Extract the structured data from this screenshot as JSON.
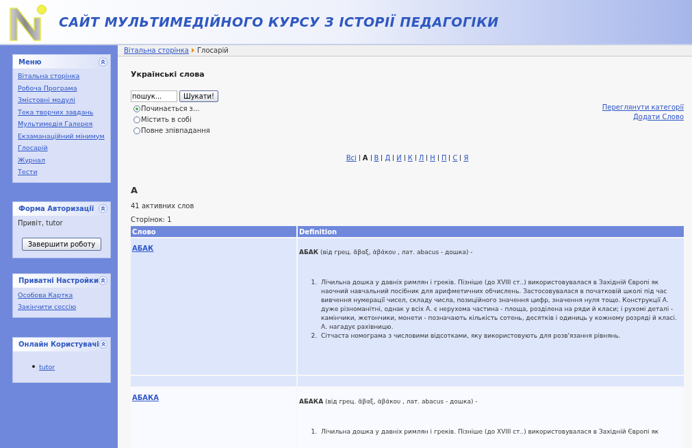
{
  "header": {
    "title": "САЙТ МУЛЬТИМЕДІЙНОГО КУРСУ З ІСТОРІЇ ПЕДАГОГІКИ"
  },
  "sidebar": {
    "menu": {
      "title": "Меню",
      "items": [
        "Вітальна сторінка",
        "Робоча Програма",
        "Змістовні модулі",
        "Тека творчих завдань",
        "Мультимедія Галерея",
        "Екзаманаційний мінимум",
        "Глосарій",
        "Журнал",
        "Тести"
      ]
    },
    "login": {
      "title": "Форма Авторизації",
      "greeting": "Привіт, tutor",
      "button": "Завершити роботу"
    },
    "settings": {
      "title": "Приватні Настройки",
      "items": [
        "Особова Картка",
        "Закінчити сессію"
      ]
    },
    "online": {
      "title": "Онлайн Користувачі",
      "users": [
        "tutor"
      ]
    }
  },
  "breadcrumb": [
    {
      "label": "Вітальна сторінка",
      "kind": "link"
    },
    {
      "label": "Глосарій",
      "kind": "current"
    }
  ],
  "glossary": {
    "heading": "Українські слова",
    "search": {
      "value": "пошук...",
      "button": "Шукати!"
    },
    "options": [
      {
        "label": "Починається з...",
        "selected": true
      },
      {
        "label": "Містить в собі",
        "selected": false
      },
      {
        "label": "Повне зпівпадання",
        "selected": false
      }
    ],
    "links": [
      "Переглянути категорії",
      "Додати Слово"
    ],
    "letters": [
      {
        "label": "Всі",
        "selected": false
      },
      {
        "label": "А",
        "selected": true
      },
      {
        "label": "В",
        "selected": false
      },
      {
        "label": "Д",
        "selected": false
      },
      {
        "label": "И",
        "selected": false
      },
      {
        "label": "К",
        "selected": false
      },
      {
        "label": "Л",
        "selected": false
      },
      {
        "label": "Н",
        "selected": false
      },
      {
        "label": "П",
        "selected": false
      },
      {
        "label": "С",
        "selected": false
      },
      {
        "label": "Я",
        "selected": false
      }
    ],
    "letter_heading": "А",
    "count": "41 активних слов",
    "pages": "Сторінок: 1",
    "table": {
      "columns": [
        "Слово",
        "Definition"
      ],
      "rows": [
        {
          "word": "АБАК",
          "intro": "**АБАК** (від грец. ἄβαξ, ἀβάκου , лат. abacus - дошка) -",
          "items": [
            {
              "number": "1.",
              "text": "Лічильна дошка у давніх римлян і греків. Пізніше (до XVIII ст..) використовувалася в Західній Європі як наочний навчальний посібник для арифметичних обчислень. Застосовувалася в початковій школі під час вивчення нумерації чисел, складу числа, позиційного значення цифр, значення нуля тощо. Конструкції А. дуже різноманітні, однак у всіх А. є нерухома частина - площа, розділена на ряди й класи; і рухомі деталі - камінчики, жетончики, монети - позначають кількість сотень, десятків і одиниць у кожному розряді й класі. А. нагадує рахівницю."
            },
            {
              "number": "2.",
              "text": "Сітчаста номограма з числовими відсотками, яку використовують для розв'язання рівнянь."
            }
          ]
        },
        {
          "word": "АБАКА",
          "intro": "**АБАКА** (від грец. ἄβαξ, ἀβάκου , лат. abacus - дошка) -",
          "items": [
            {
              "number": "1.",
              "text": "Лічильна дошка у давніх римлян і греків. Пізніше (до XVIII ст..) використовувалася в Західній Європі як"
            }
          ]
        }
      ]
    }
  }
}
